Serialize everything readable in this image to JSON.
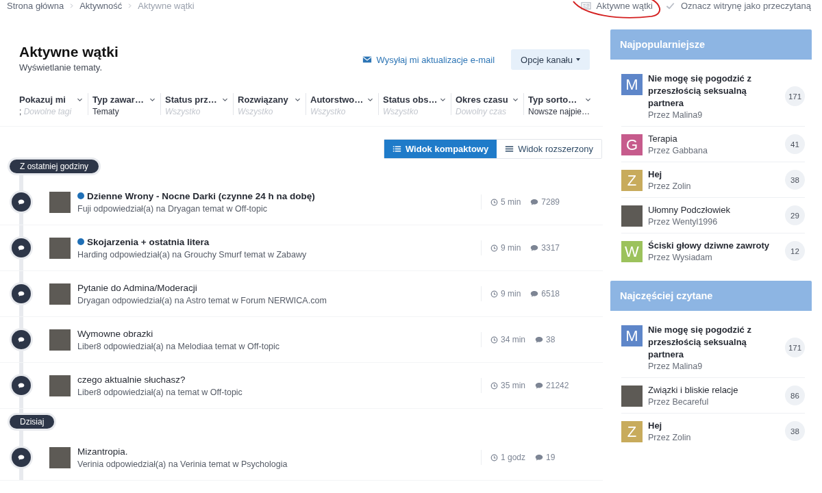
{
  "breadcrumb": [
    {
      "label": "Strona główna",
      "current": false
    },
    {
      "label": "Aktywność",
      "current": false
    },
    {
      "label": "Aktywne wątki",
      "current": true
    }
  ],
  "top_links": [
    {
      "label": "Aktywne wątki",
      "kind": "stream"
    },
    {
      "label": "Oznacz witrynę jako przeczytaną",
      "kind": "mark-read"
    }
  ],
  "page": {
    "title": "Aktywne wątki",
    "subtitle": "Wyświetlanie tematy.",
    "follow_link": "Wysyłaj mi aktualizacje e-mail",
    "options_button": "Opcje kanału"
  },
  "filters": [
    {
      "label": "Pokazuj mi",
      "value": ";",
      "placeholder": "Dowolne tagi"
    },
    {
      "label": "Typ zawar…",
      "value": "Tematy"
    },
    {
      "label": "Status prz…",
      "placeholder": "Wszystko"
    },
    {
      "label": "Rozwiązany",
      "placeholder": "Wszystko"
    },
    {
      "label": "Autorstwo…",
      "placeholder": "Wszystko"
    },
    {
      "label": "Status obs…",
      "placeholder": "Wszystko"
    },
    {
      "label": "Okres czasu",
      "placeholder": "Dowolny czas"
    },
    {
      "label": "Typ sorto…",
      "value": "Nowsze najpie…"
    }
  ],
  "view_toggle": [
    {
      "label": "Widok kompaktowy",
      "kind": "compact",
      "selected": true
    },
    {
      "label": "Widok rozszerzony",
      "kind": "expanded",
      "selected": false
    }
  ],
  "stream": [
    {
      "section": "Z ostatniej godziny",
      "items": [
        {
          "title": "Dzienne Wrony - Nocne Darki (czynne 24 h na dobę)",
          "unread": true,
          "summary": "Fuji odpowiedział(a) na Dryagan temat w Off-topic",
          "time": "5 min",
          "replies": "7289"
        },
        {
          "title": "Skojarzenia + ostatnia litera",
          "unread": true,
          "summary": "Harding odpowiedział(a) na Grouchy Smurf temat w Zabawy",
          "time": "9 min",
          "replies": "3317"
        },
        {
          "title": "Pytanie do Admina/Moderacji",
          "unread": false,
          "summary": "Dryagan odpowiedział(a) na Astro temat w Forum NERWICA.com",
          "time": "9 min",
          "replies": "6518"
        },
        {
          "title": "Wymowne obrazki",
          "unread": false,
          "summary": "Liber8 odpowiedział(a) na Melodiaa temat w Off-topic",
          "time": "34 min",
          "replies": "38"
        },
        {
          "title": "czego aktualnie słuchasz?",
          "unread": false,
          "summary": "Liber8 odpowiedział(a) na temat w Off-topic",
          "time": "35 min",
          "replies": "21242"
        }
      ]
    },
    {
      "section": "Dzisiaj",
      "items": [
        {
          "title": "Mizantropia.",
          "unread": false,
          "summary": "Verinia odpowiedział(a) na Verinia temat w Psychologia",
          "time": "1 godz",
          "replies": "19"
        }
      ]
    }
  ],
  "sidebar": [
    {
      "title": "Najpopularniejsze",
      "items": [
        {
          "title": "Nie mogę się pogodzić z przeszłością seksualną partnera",
          "unread": true,
          "author": "Przez Malina9",
          "count": "171",
          "avatar": {
            "kind": "letter",
            "letter": "M",
            "color": "#5e86c9"
          }
        },
        {
          "title": "Terapia",
          "unread": false,
          "author": "Przez Gabbana",
          "count": "41",
          "avatar": {
            "kind": "letter",
            "letter": "G",
            "color": "#c65b8c"
          }
        },
        {
          "title": "Hej",
          "unread": true,
          "author": "Przez Zolin",
          "count": "38",
          "avatar": {
            "kind": "letter",
            "letter": "Z",
            "color": "#c8ab5c"
          }
        },
        {
          "title": "Ułomny Podczłowiek",
          "unread": false,
          "author": "Przez Wentyl1996",
          "count": "29",
          "avatar": {
            "kind": "photo"
          }
        },
        {
          "title": "Ściski głowy dziwne zawroty",
          "unread": true,
          "author": "Przez Wysiadam",
          "count": "12",
          "avatar": {
            "kind": "letter",
            "letter": "W",
            "color": "#9cc25c"
          }
        }
      ]
    },
    {
      "title": "Najczęściej czytane",
      "items": [
        {
          "title": "Nie mogę się pogodzić z przeszłością seksualną partnera",
          "unread": true,
          "author": "Przez Malina9",
          "count": "171",
          "avatar": {
            "kind": "letter",
            "letter": "M",
            "color": "#5e86c9"
          }
        },
        {
          "title": "Związki i bliskie relacje",
          "unread": false,
          "author": "Przez Becareful",
          "count": "86",
          "avatar": {
            "kind": "photo"
          }
        },
        {
          "title": "Hej",
          "unread": true,
          "author": "Przez Zolin",
          "count": "38",
          "avatar": {
            "kind": "letter",
            "letter": "Z",
            "color": "#c8ab5c"
          }
        }
      ]
    }
  ]
}
